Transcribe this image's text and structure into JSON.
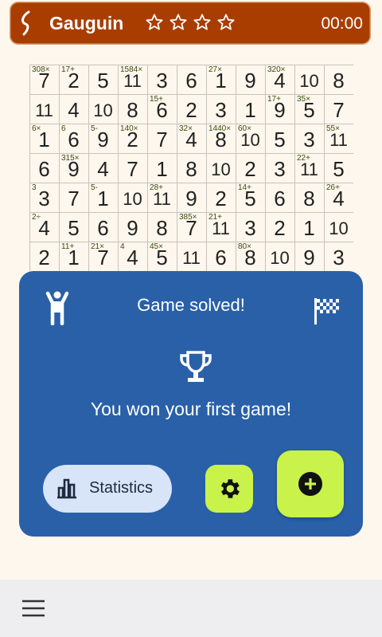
{
  "app": {
    "title": "Gauguin",
    "timer": "00:00",
    "stars": 4
  },
  "grid": {
    "values": [
      [
        "7",
        "2",
        "5",
        "11",
        "3",
        "6",
        "1",
        "9",
        "4",
        "10",
        "8"
      ],
      [
        "11",
        "4",
        "10",
        "8",
        "6",
        "2",
        "3",
        "1",
        "9",
        "5",
        "7"
      ],
      [
        "1",
        "6",
        "9",
        "2",
        "7",
        "4",
        "8",
        "10",
        "5",
        "3",
        "11"
      ],
      [
        "6",
        "9",
        "4",
        "7",
        "1",
        "8",
        "10",
        "2",
        "3",
        "11",
        "5"
      ],
      [
        "3",
        "7",
        "1",
        "10",
        "11",
        "9",
        "2",
        "5",
        "6",
        "8",
        "4"
      ],
      [
        "4",
        "5",
        "6",
        "9",
        "8",
        "7",
        "11",
        "3",
        "2",
        "1",
        "10"
      ],
      [
        "2",
        "1",
        "7",
        "4",
        "5",
        "11",
        "6",
        "8",
        "10",
        "9",
        "3"
      ]
    ],
    "cages": [
      {
        "r": 0,
        "c": 0,
        "label": "308×"
      },
      {
        "r": 0,
        "c": 1,
        "label": "17+"
      },
      {
        "r": 0,
        "c": 3,
        "label": "1584×"
      },
      {
        "r": 0,
        "c": 6,
        "label": "27×"
      },
      {
        "r": 0,
        "c": 8,
        "label": "320×"
      },
      {
        "r": 1,
        "c": 4,
        "label": "15+"
      },
      {
        "r": 1,
        "c": 8,
        "label": "17+"
      },
      {
        "r": 1,
        "c": 9,
        "label": "35×"
      },
      {
        "r": 2,
        "c": 0,
        "label": "6×"
      },
      {
        "r": 2,
        "c": 1,
        "label": "6"
      },
      {
        "r": 2,
        "c": 2,
        "label": "5-"
      },
      {
        "r": 2,
        "c": 3,
        "label": "140×"
      },
      {
        "r": 2,
        "c": 5,
        "label": "32×"
      },
      {
        "r": 2,
        "c": 6,
        "label": "1440×"
      },
      {
        "r": 2,
        "c": 7,
        "label": "60×"
      },
      {
        "r": 2,
        "c": 10,
        "label": "55×"
      },
      {
        "r": 3,
        "c": 1,
        "label": "315×"
      },
      {
        "r": 3,
        "c": 9,
        "label": "22+"
      },
      {
        "r": 4,
        "c": 0,
        "label": "3"
      },
      {
        "r": 4,
        "c": 2,
        "label": "5-"
      },
      {
        "r": 4,
        "c": 4,
        "label": "28+"
      },
      {
        "r": 4,
        "c": 7,
        "label": "14+"
      },
      {
        "r": 4,
        "c": 10,
        "label": "26+"
      },
      {
        "r": 5,
        "c": 0,
        "label": "2÷"
      },
      {
        "r": 5,
        "c": 5,
        "label": "385×"
      },
      {
        "r": 5,
        "c": 6,
        "label": "21+"
      },
      {
        "r": 6,
        "c": 1,
        "label": "11+"
      },
      {
        "r": 6,
        "c": 2,
        "label": "21×"
      },
      {
        "r": 6,
        "c": 3,
        "label": "4"
      },
      {
        "r": 6,
        "c": 4,
        "label": "45×"
      },
      {
        "r": 6,
        "c": 7,
        "label": "80×"
      }
    ]
  },
  "dialog": {
    "title": "Game solved!",
    "message": "You won your first game!",
    "stats_label": "Statistics"
  },
  "colors": {
    "topbar": "#a93d00",
    "dialog": "#2a60a8",
    "accent": "#c9f24a",
    "stats_bg": "#d8e4f8"
  },
  "icons": [
    "gauguin-logo-icon",
    "star-icon",
    "person-cheer-icon",
    "flag-icon",
    "trophy-icon",
    "bar-chart-icon",
    "gear-icon",
    "plus-circle-icon",
    "menu-icon"
  ]
}
